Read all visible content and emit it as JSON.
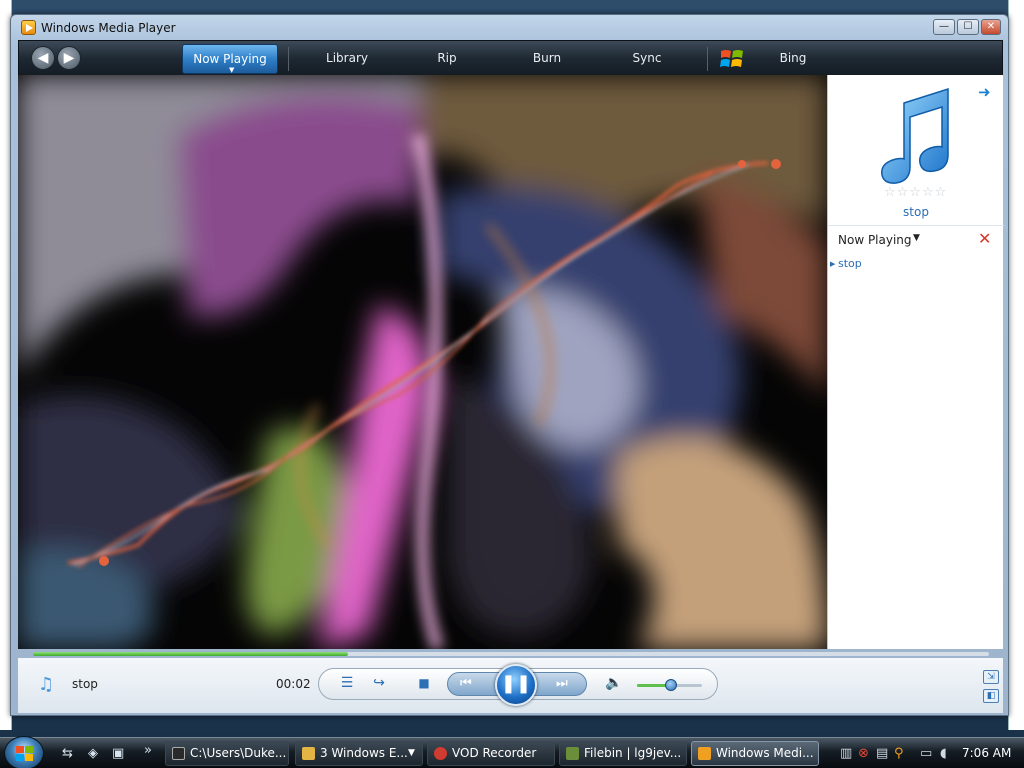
{
  "window": {
    "title": "Windows Media Player",
    "minimize": "—",
    "maximize": "☐",
    "close": "✕"
  },
  "nav": {
    "back_glyph": "◀",
    "forward_glyph": "▶",
    "tabs": [
      {
        "label": "Now Playing",
        "active": true
      },
      {
        "label": "Library"
      },
      {
        "label": "Rip"
      },
      {
        "label": "Burn"
      },
      {
        "label": "Sync"
      },
      {
        "label": "Bing"
      }
    ],
    "logo_icon": "windows-logo-icon"
  },
  "pane": {
    "art_icon": "music-note-icon",
    "rating_stars": "☆☆☆☆☆",
    "song": "stop",
    "playlist_title": "Now Playing",
    "dropdown_glyph": "▼",
    "clear_glyph": "✕",
    "items": [
      {
        "label": "stop"
      }
    ],
    "nav_glyph": "➜"
  },
  "playback": {
    "status_track": "stop",
    "time": "00:02",
    "progress": 0.33,
    "volume": 0.52,
    "shuffle_glyph": "☰",
    "repeat_glyph": "↪",
    "stop_glyph": "■",
    "prev_glyph": "⏮",
    "play_glyph": "❚❚",
    "next_glyph": "⏭",
    "volume_glyph": "🔈",
    "switch_glyph": "⇲",
    "compact_glyph": "◧"
  },
  "colors": {
    "accent": "#2f7fc8",
    "nav_bg": "#1f2933",
    "seek_fill": "#3faa2a"
  },
  "taskbar": {
    "buttons": [
      {
        "label": "C:\\Users\\Duke...",
        "icon": "cmd-icon",
        "color": "#2a2a2a"
      },
      {
        "label": "3 Windows E...",
        "icon": "folder-icon",
        "color": "#e3b545"
      },
      {
        "label": "VOD Recorder",
        "icon": "recorder-icon",
        "color": "#d03c2f"
      },
      {
        "label": "Filebin | lg9jev...",
        "icon": "filebin-icon",
        "color": "#6a8e3a"
      },
      {
        "label": "Windows Medi...",
        "icon": "wmp-icon",
        "color": "#f0a020",
        "active": true
      }
    ],
    "overflow_glyph": "»",
    "clock": "7:06 AM"
  }
}
